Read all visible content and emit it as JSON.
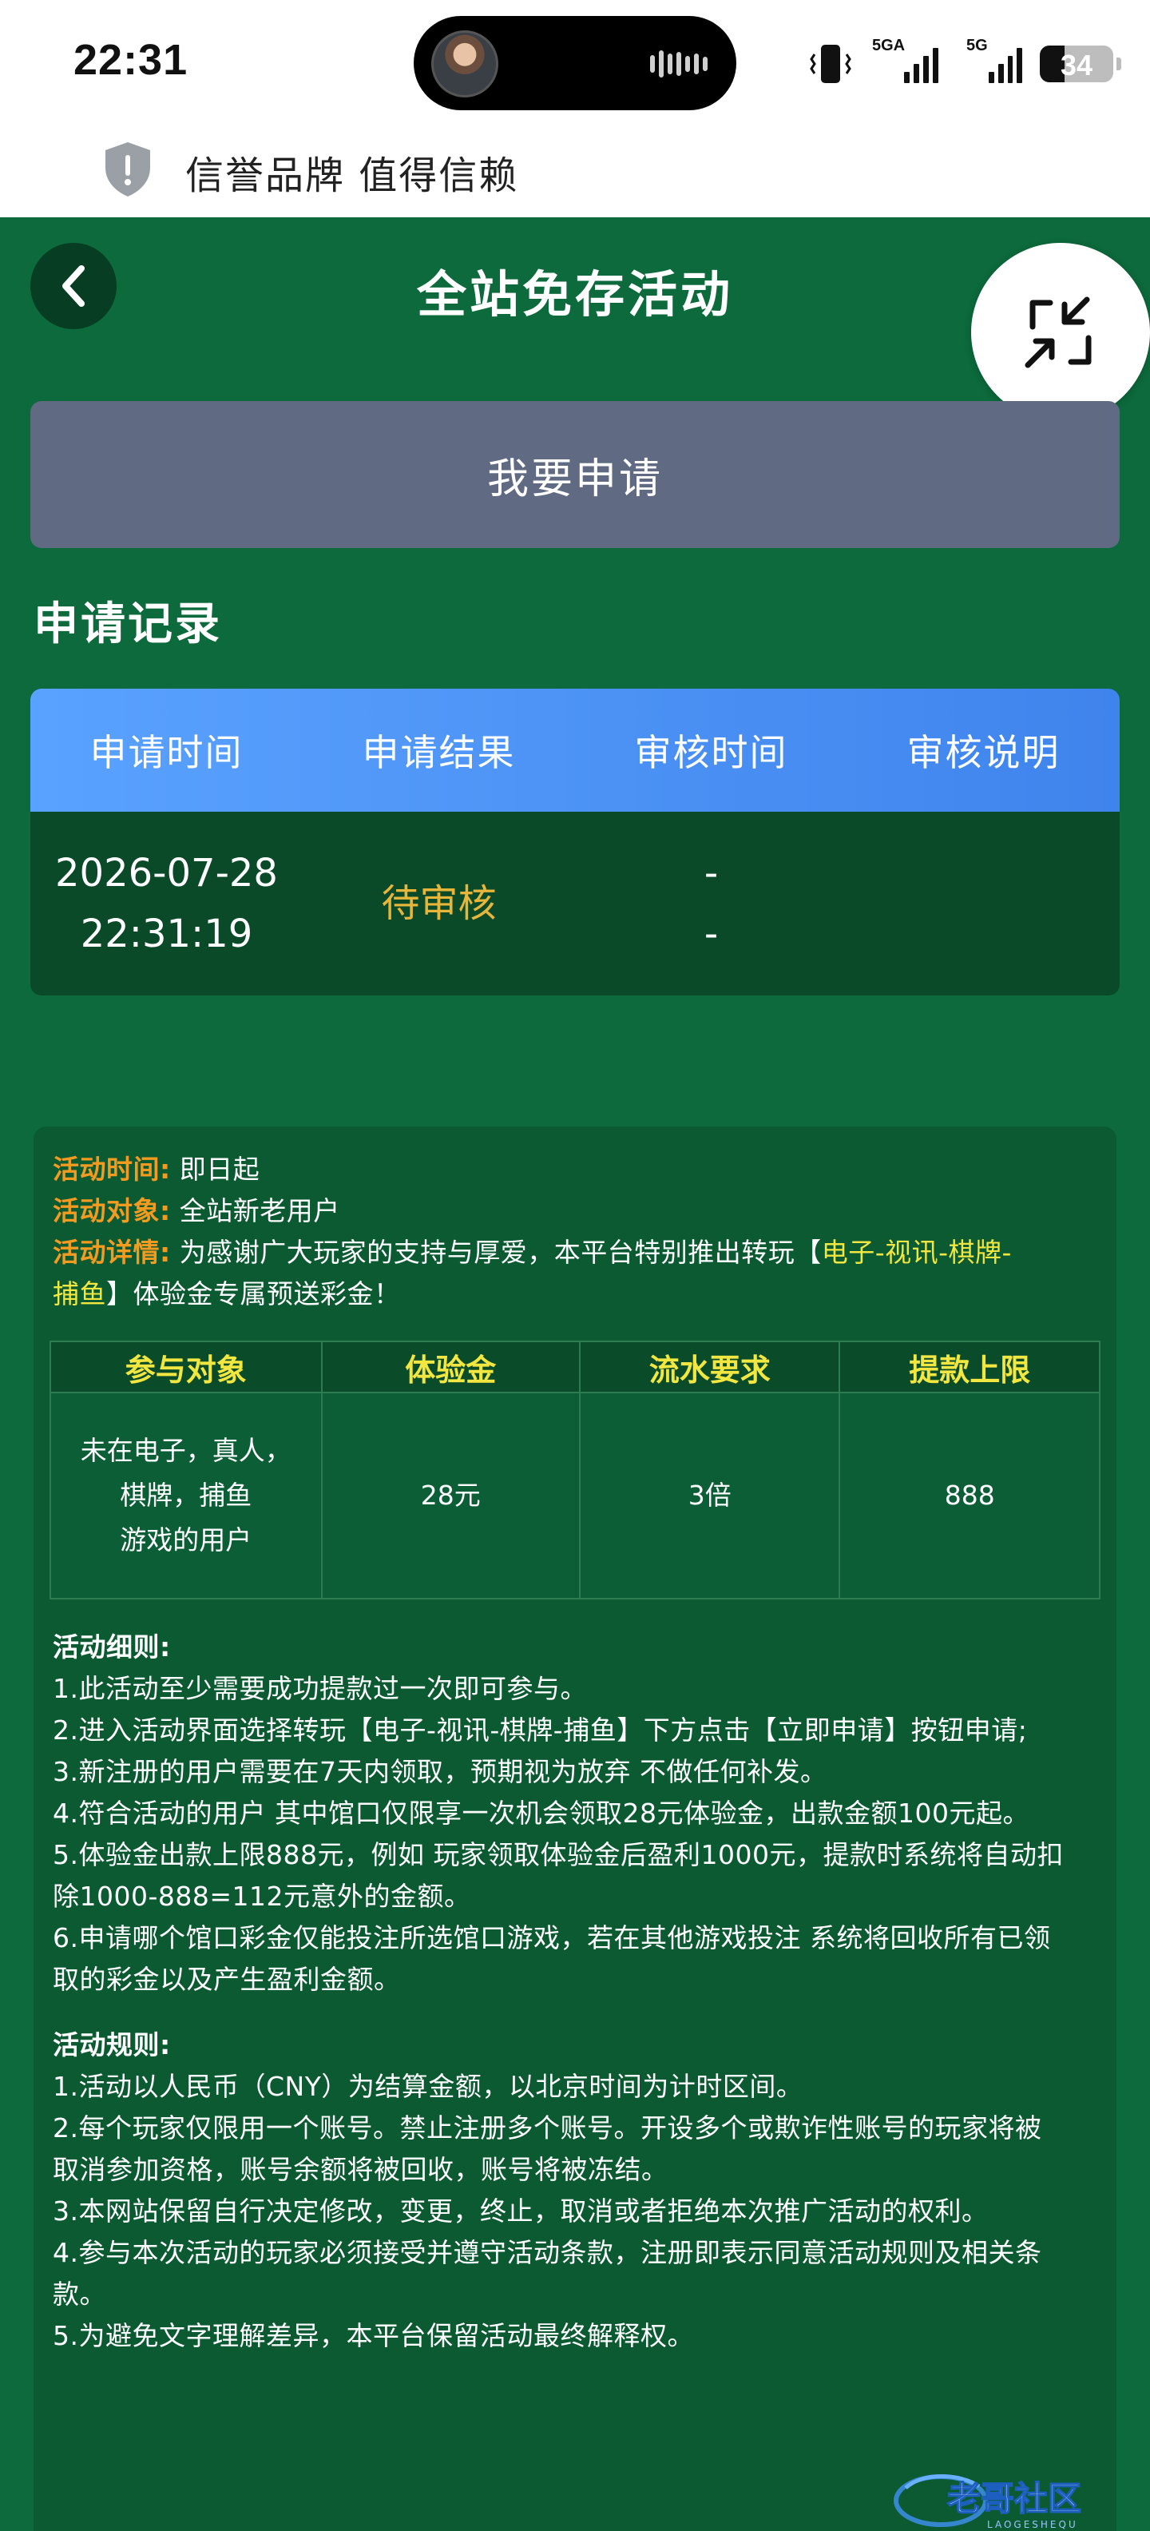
{
  "status_bar": {
    "time": "22:31",
    "signal_1_tag": "5GA",
    "signal_2_tag": "5G",
    "battery": "34",
    "icons": [
      "vibrate-icon",
      "signal-icon",
      "battery-icon"
    ]
  },
  "trust_banner": {
    "text": "信誉品牌 值得信赖",
    "icon": "shield-icon"
  },
  "header": {
    "title": "全站免存活动",
    "back_icon": "back-arrow-icon",
    "float_icon": "minimize-arrows-icon"
  },
  "apply_button": "我要申请",
  "records": {
    "title": "申请记录",
    "columns": [
      "申请时间",
      "申请结果",
      "审核时间",
      "审核说明"
    ],
    "rows": [
      {
        "date": "2026-07-28",
        "time": "22:31:19",
        "result": "待审核",
        "review_line1": "-",
        "review_line2": "-",
        "note": ""
      }
    ]
  },
  "activity": {
    "time_label": "活动时间:",
    "time_value": "即日起",
    "target_label": "活动对象:",
    "target_value": "全站新老用户",
    "detail_label": "活动详情:",
    "detail_text_a": "为感谢广大玩家的支持与厚爱，本平台特别推出转玩【",
    "detail_highlight_a": "电子-视讯-棋牌-",
    "detail_highlight_b": "捕鱼",
    "detail_text_b": "】体验金专属预送彩金！",
    "table": {
      "headers": [
        "参与对象",
        "体验金",
        "流水要求",
        "提款上限"
      ],
      "target_lines": [
        "未在电子，真人，",
        "棋牌，捕鱼",
        "游戏的用户"
      ],
      "amount": "28元",
      "turnover": "3倍",
      "limit": "888"
    },
    "details_title": "活动细则:",
    "details": [
      "1.此活动至少需要成功提款过一次即可参与。",
      "2.进入活动界面选择转玩【电子-视讯-棋牌-捕鱼】下方点击【立即申请】按钮申请;",
      "3.新注册的用户需要在7天内领取，预期视为放弃 不做任何补发。",
      "4.符合活动的用户 其中馆口仅限享一次机会领取28元体验金，出款金额100元起。",
      "5.体验金出款上限888元，例如 玩家领取体验金后盈利1000元，提款时系统将自动扣",
      "除1000-888=112元意外的金额。",
      "6.申请哪个馆口彩金仅能投注所选馆口游戏，若在其他游戏投注 系统将回收所有已领",
      "取的彩金以及产生盈利金额。"
    ],
    "rules_title": "活动规则:",
    "rules": [
      "1.活动以人民币（CNY）为结算金额，以北京时间为计时区间。",
      "2.每个玩家仅限用一个账号。禁止注册多个账号。开设多个或欺诈性账号的玩家将被",
      "取消参加资格，账号余额将被回收，账号将被冻结。",
      "3.本网站保留自行决定修改，变更，终止，取消或者拒绝本次推广活动的权利。",
      "4.参与本次活动的玩家必须接受并遵守活动条款，注册即表示同意活动规则及相关条",
      "款。",
      "5.为避免文字理解差异，本平台保留活动最终解释权。"
    ]
  },
  "watermark": {
    "text": "老哥社区",
    "sub": "LAOGESHEQU"
  },
  "colors": {
    "page_bg": "#0c6a3c",
    "panel_bg": "#0b5a32",
    "apply_button": "#616a83",
    "table_header_gradient": [
      "#5aa2ff",
      "#3f84ec"
    ],
    "pending_status": "#e6b53a",
    "label_orange": "#f39b21",
    "highlight_yellow": "#f2e640"
  }
}
